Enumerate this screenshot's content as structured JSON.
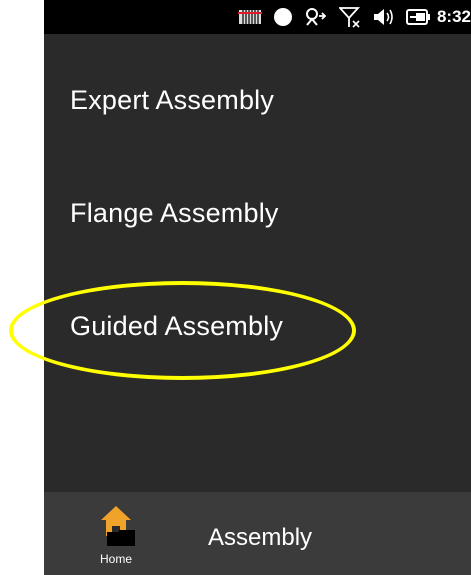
{
  "status_bar": {
    "time": "8:32",
    "icons": [
      "signal-bars-icon",
      "record-dot-icon",
      "network-activity-icon",
      "no-signal-icon",
      "volume-icon",
      "battery-icon"
    ]
  },
  "menu": {
    "items": [
      {
        "label": "Expert Assembly"
      },
      {
        "label": "Flange Assembly"
      },
      {
        "label": "Guided Assembly",
        "highlighted": true
      }
    ]
  },
  "app_bar": {
    "home_label": "Home",
    "title": "Assembly"
  },
  "colors": {
    "background": "#2a2a2a",
    "status_bar": "#000000",
    "app_bar": "#3b3b3b",
    "highlight": "#ffff00",
    "home_icon": "#f0a32a"
  }
}
